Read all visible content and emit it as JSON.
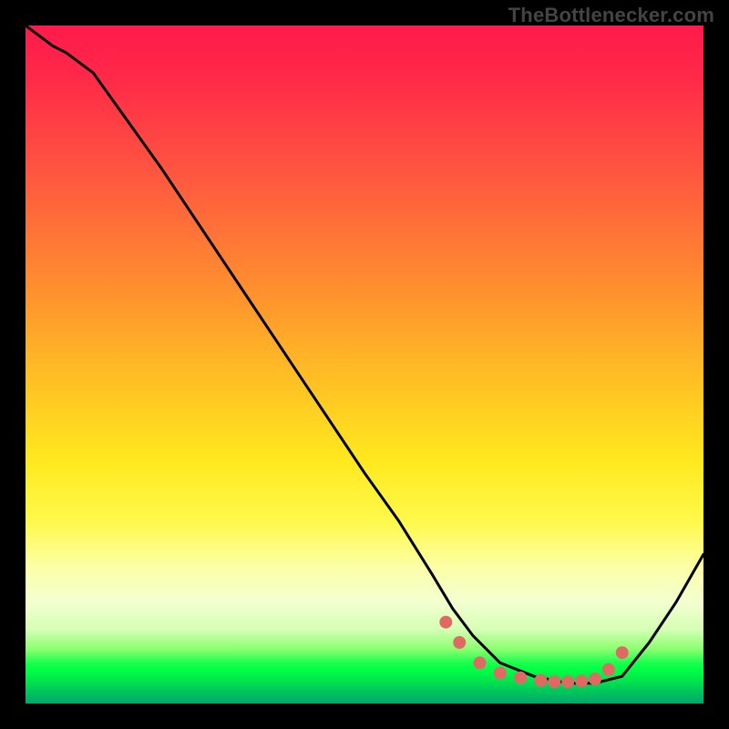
{
  "watermark": "TheBottleneсker.com",
  "chart_data": {
    "type": "line",
    "title": "",
    "xlabel": "",
    "ylabel": "",
    "xlim": [
      0,
      100
    ],
    "ylim": [
      0,
      100
    ],
    "series": [
      {
        "name": "curve",
        "x": [
          0,
          4,
          6,
          10,
          20,
          30,
          40,
          50,
          55,
          60,
          63,
          66,
          70,
          75,
          80,
          84,
          88,
          92,
          96,
          100
        ],
        "y": [
          100,
          97,
          96,
          93,
          79,
          64,
          49,
          34,
          27,
          19,
          14,
          10,
          6,
          4,
          3,
          3,
          4,
          9,
          15,
          22
        ]
      }
    ],
    "markers": {
      "name": "points",
      "x": [
        62,
        64,
        67,
        70,
        73,
        76,
        78,
        80,
        82,
        84,
        86,
        88
      ],
      "y": [
        12,
        9,
        6,
        4.5,
        3.8,
        3.4,
        3.2,
        3.2,
        3.3,
        3.6,
        5,
        7.5
      ],
      "color": "#e06a63",
      "radius": 7
    },
    "gradient_stops": [
      {
        "pos": 0.0,
        "color": "#ff1a4b"
      },
      {
        "pos": 0.5,
        "color": "#ffd224"
      },
      {
        "pos": 0.8,
        "color": "#fcffa8"
      },
      {
        "pos": 0.94,
        "color": "#1bff4e"
      },
      {
        "pos": 1.0,
        "color": "#00a86a"
      }
    ]
  }
}
